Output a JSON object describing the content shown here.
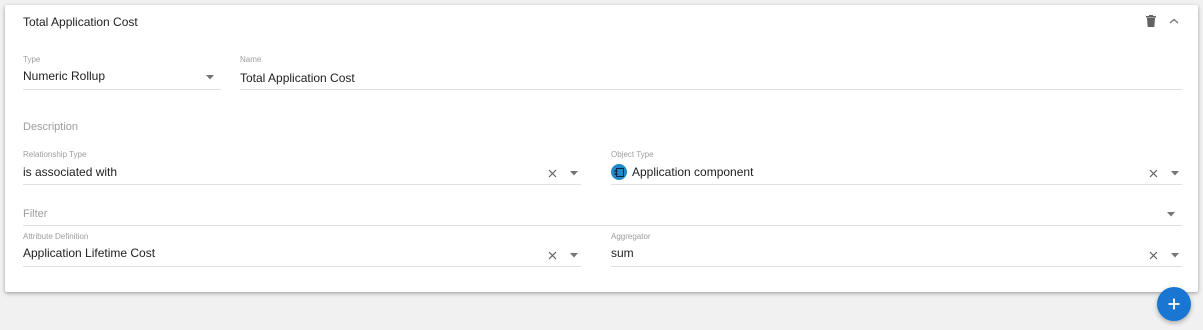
{
  "card": {
    "title": "Total Application Cost",
    "delete_icon": "trash-icon",
    "collapse_icon": "chevron-up-icon"
  },
  "fields": {
    "type": {
      "label": "Type",
      "value": "Numeric Rollup"
    },
    "name": {
      "label": "Name",
      "value": "Total Application Cost"
    },
    "description": {
      "placeholder": "Description"
    },
    "relationship_type": {
      "label": "Relationship Type",
      "value": "is associated with"
    },
    "object_type": {
      "label": "Object Type",
      "value": "Application component",
      "icon": "application-component-icon",
      "icon_color": "#1e88c8"
    },
    "filter": {
      "placeholder": "Filter"
    },
    "attribute_definition": {
      "label": "Attribute Definition",
      "value": "Application Lifetime Cost"
    },
    "aggregator": {
      "label": "Aggregator",
      "value": "sum"
    }
  },
  "fab": {
    "icon": "plus-icon",
    "color": "#1976d2"
  }
}
